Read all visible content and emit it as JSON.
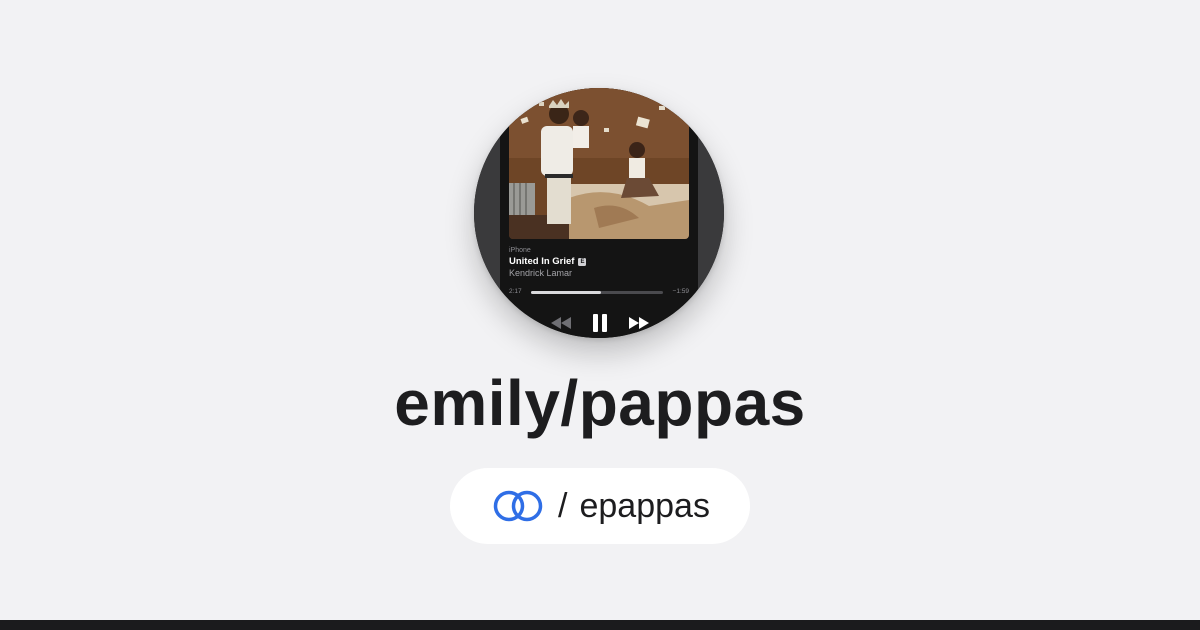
{
  "now_playing": {
    "source": "iPhone",
    "title": "United In Grief",
    "explicit_badge": "E",
    "artist": "Kendrick Lamar",
    "elapsed": "2:17",
    "remaining": "−1:59",
    "progress": 0.53,
    "icons": [
      "rewind-icon",
      "pause-icon",
      "fast-forward-icon"
    ]
  },
  "profile": {
    "name": "emily/pappas",
    "handle_separator": "/",
    "handle": "epappas",
    "logo_icon": "interlocking-rings-icon"
  },
  "colors": {
    "background": "#f2f2f4",
    "text": "#1d1d1f",
    "logo_blue": "#2f6ee6",
    "bottom_bar": "#1b1b1d"
  }
}
